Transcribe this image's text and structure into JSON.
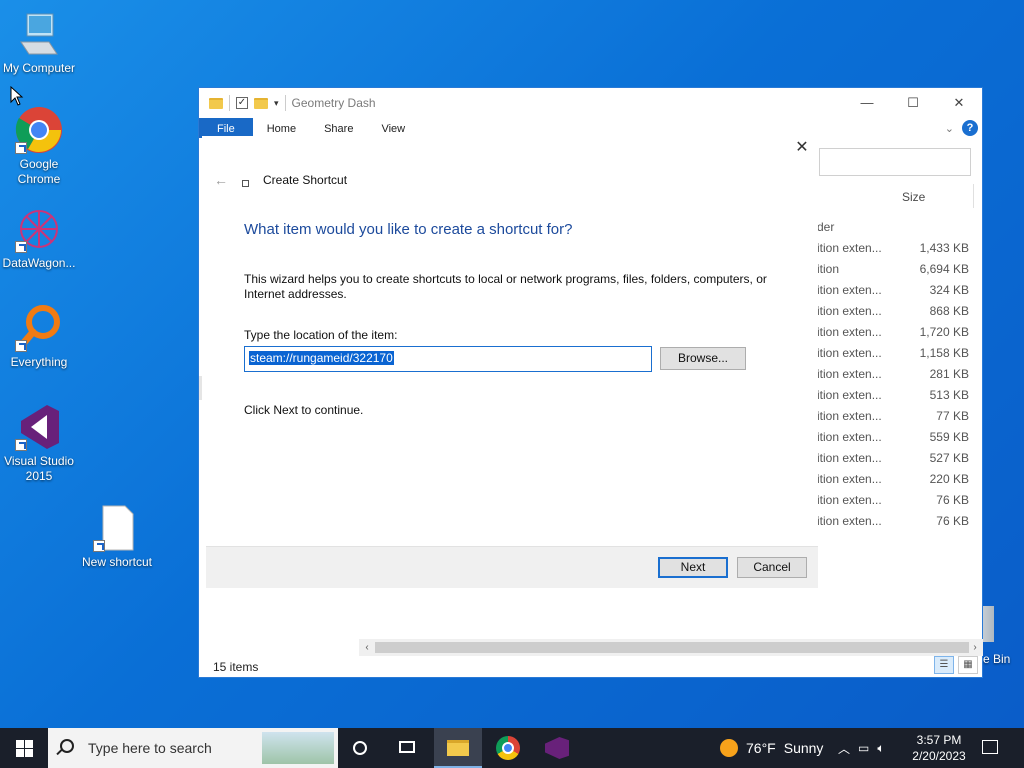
{
  "desktop": {
    "icons": [
      {
        "label": "My Computer"
      },
      {
        "label": "Google Chrome"
      },
      {
        "label": "DataWagon..."
      },
      {
        "label": "Everything"
      },
      {
        "label": "Visual Studio 2015"
      },
      {
        "label": "New shortcut"
      }
    ],
    "recycle_bin_label": "e Bin"
  },
  "explorer": {
    "title": "Geometry Dash",
    "controls": {
      "minimize": "—",
      "maximize": "☐",
      "close": "✕"
    },
    "ribbon_tabs": [
      "File",
      "Home",
      "Share",
      "View"
    ],
    "column_size": "Size",
    "rows": [
      {
        "type": "der",
        "size": ""
      },
      {
        "type": "ition exten...",
        "size": "1,433 KB"
      },
      {
        "type": "ition",
        "size": "6,694 KB"
      },
      {
        "type": "ition exten...",
        "size": "324 KB"
      },
      {
        "type": "ition exten...",
        "size": "868 KB"
      },
      {
        "type": "ition exten...",
        "size": "1,720 KB"
      },
      {
        "type": "ition exten...",
        "size": "1,158 KB"
      },
      {
        "type": "ition exten...",
        "size": "281 KB"
      },
      {
        "type": "ition exten...",
        "size": "513 KB"
      },
      {
        "type": "ition exten...",
        "size": "77 KB"
      },
      {
        "type": "ition exten...",
        "size": "559 KB"
      },
      {
        "type": "ition exten...",
        "size": "527 KB"
      },
      {
        "type": "ition exten...",
        "size": "220 KB"
      },
      {
        "type": "ition exten...",
        "size": "76 KB"
      },
      {
        "type": "ition exten...",
        "size": "76 KB"
      }
    ],
    "status": "15 items"
  },
  "wizard": {
    "caption": "Create Shortcut",
    "heading": "What item would you like to create a shortcut for?",
    "description": "This wizard helps you to create shortcuts to local or network programs, files, folders, computers, or Internet addresses.",
    "location_label": "Type the location of the item:",
    "location_value": "steam://rungameid/322170",
    "browse_label": "Browse...",
    "continue_text": "Click Next to continue.",
    "next_label": "Next",
    "cancel_label": "Cancel"
  },
  "taskbar": {
    "search_placeholder": "Type here to search",
    "weather_temp": "76°F",
    "weather_cond": "Sunny",
    "time": "3:57 PM",
    "date": "2/20/2023"
  },
  "colors": {
    "accent": "#1a6fd0",
    "heading": "#1c4a9c",
    "taskbar": "#1a1f2a"
  }
}
